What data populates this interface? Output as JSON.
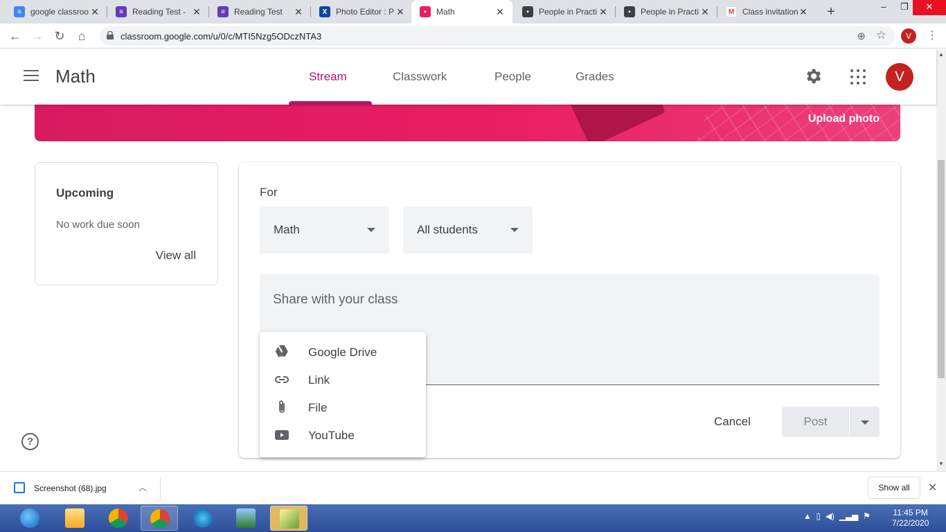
{
  "browser": {
    "tabs": [
      {
        "title": "google classroo",
        "favicon_color": "#4285f4",
        "favicon_glyph": "docs-icon"
      },
      {
        "title": "Reading Test - ",
        "favicon_color": "#673ab7",
        "favicon_glyph": "forms-icon"
      },
      {
        "title": "Reading Test",
        "favicon_color": "#673ab7",
        "favicon_glyph": "forms-icon"
      },
      {
        "title": "Photo Editor : P",
        "favicon_color": "#0d47a1",
        "favicon_glyph": "photo-editor-icon"
      },
      {
        "title": "Math",
        "favicon_color": "#e91e63",
        "favicon_glyph": "classroom-icon",
        "active": true
      },
      {
        "title": "People in Practi",
        "favicon_color": "#3c4043",
        "favicon_glyph": "classroom-icon"
      },
      {
        "title": "People in Practi",
        "favicon_color": "#3c4043",
        "favicon_glyph": "classroom-icon"
      },
      {
        "title": "Class invitation",
        "favicon_color": "#ea4335",
        "favicon_glyph": "gmail-icon"
      }
    ],
    "url": "classroom.google.com/u/0/c/MTI5Nzg5ODczNTA3",
    "profile_initial": "V"
  },
  "header": {
    "class_name": "Math",
    "nav": {
      "stream": "Stream",
      "classwork": "Classwork",
      "people": "People",
      "grades": "Grades"
    },
    "user_initial": "V"
  },
  "banner": {
    "upload_label": "Upload photo"
  },
  "upcoming": {
    "title": "Upcoming",
    "status": "No work due soon",
    "view_all": "View all"
  },
  "composer": {
    "for_label": "For",
    "class_select": "Math",
    "audience_select": "All students",
    "placeholder": "Share with your class",
    "cancel": "Cancel",
    "post": "Post"
  },
  "add_menu": {
    "items": [
      {
        "label": "Google Drive",
        "icon": "drive-icon"
      },
      {
        "label": "Link",
        "icon": "link-icon"
      },
      {
        "label": "File",
        "icon": "attachment-icon"
      },
      {
        "label": "YouTube",
        "icon": "youtube-icon"
      }
    ]
  },
  "downloads": {
    "filename": "Screenshot (68).jpg",
    "show_all": "Show all"
  },
  "taskbar": {
    "time": "11:45 PM",
    "date": "7/22/2020"
  },
  "colors": {
    "accent": "#b31471",
    "avatar": "#c5221f",
    "banner": "#e91e63"
  }
}
